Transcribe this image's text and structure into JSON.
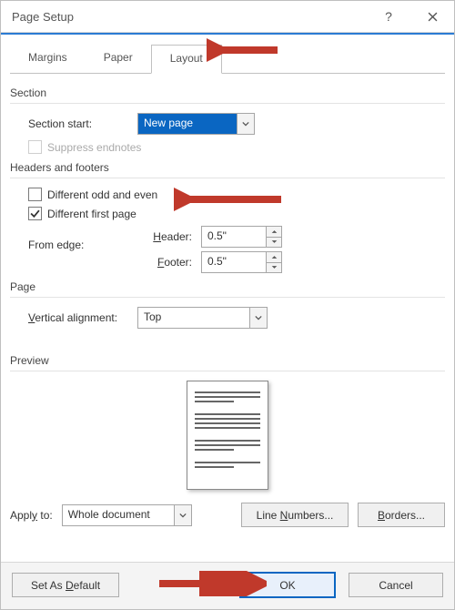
{
  "titlebar": {
    "title": "Page Setup"
  },
  "tabs": {
    "margins": "Margins",
    "paper": "Paper",
    "layout": "Layout"
  },
  "section": {
    "group": "Section",
    "start_label": "Section start:",
    "start_value": "New page",
    "suppress_endnotes": "Suppress endnotes"
  },
  "hf": {
    "group": "Headers and footers",
    "diff_odd_even": "Different odd and even",
    "diff_first": "Different first page",
    "from_edge": "From edge:",
    "header_label": "Header:",
    "header_value": "0.5\"",
    "footer_label": "Footer:",
    "footer_value": "0.5\""
  },
  "page": {
    "group": "Page",
    "va_label": "Vertical alignment:",
    "va_value": "Top"
  },
  "preview": {
    "group": "Preview"
  },
  "apply": {
    "label": "Apply to:",
    "value": "Whole document",
    "line_numbers": "Line Numbers...",
    "borders": "Borders..."
  },
  "footer": {
    "set_default": "Set As Default",
    "ok": "OK",
    "cancel": "Cancel"
  },
  "accents": {
    "selected_bg": "#0a66c2",
    "arrow": "#c0392b"
  }
}
